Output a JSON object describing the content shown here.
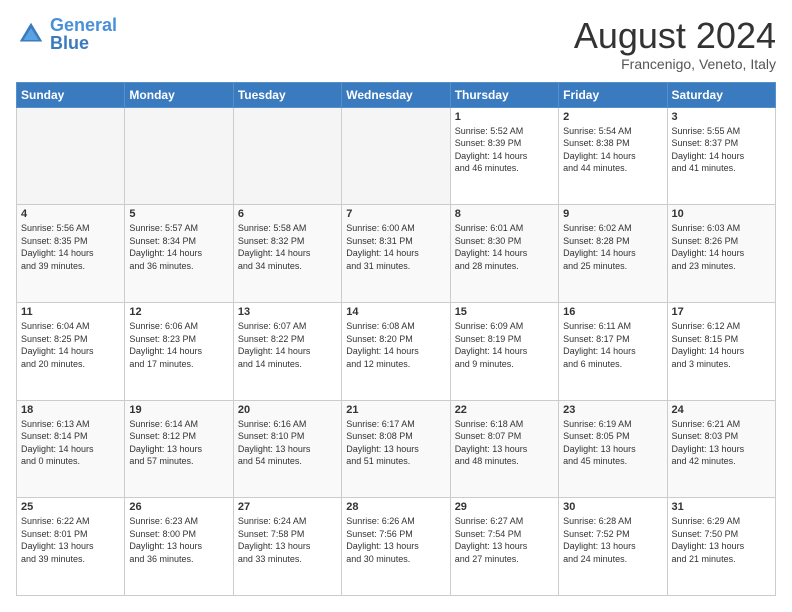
{
  "logo": {
    "line1": "General",
    "line2": "Blue"
  },
  "title": "August 2024",
  "subtitle": "Francenigo, Veneto, Italy",
  "days_of_week": [
    "Sunday",
    "Monday",
    "Tuesday",
    "Wednesday",
    "Thursday",
    "Friday",
    "Saturday"
  ],
  "weeks": [
    [
      {
        "day": "",
        "info": ""
      },
      {
        "day": "",
        "info": ""
      },
      {
        "day": "",
        "info": ""
      },
      {
        "day": "",
        "info": ""
      },
      {
        "day": "1",
        "info": "Sunrise: 5:52 AM\nSunset: 8:39 PM\nDaylight: 14 hours\nand 46 minutes."
      },
      {
        "day": "2",
        "info": "Sunrise: 5:54 AM\nSunset: 8:38 PM\nDaylight: 14 hours\nand 44 minutes."
      },
      {
        "day": "3",
        "info": "Sunrise: 5:55 AM\nSunset: 8:37 PM\nDaylight: 14 hours\nand 41 minutes."
      }
    ],
    [
      {
        "day": "4",
        "info": "Sunrise: 5:56 AM\nSunset: 8:35 PM\nDaylight: 14 hours\nand 39 minutes."
      },
      {
        "day": "5",
        "info": "Sunrise: 5:57 AM\nSunset: 8:34 PM\nDaylight: 14 hours\nand 36 minutes."
      },
      {
        "day": "6",
        "info": "Sunrise: 5:58 AM\nSunset: 8:32 PM\nDaylight: 14 hours\nand 34 minutes."
      },
      {
        "day": "7",
        "info": "Sunrise: 6:00 AM\nSunset: 8:31 PM\nDaylight: 14 hours\nand 31 minutes."
      },
      {
        "day": "8",
        "info": "Sunrise: 6:01 AM\nSunset: 8:30 PM\nDaylight: 14 hours\nand 28 minutes."
      },
      {
        "day": "9",
        "info": "Sunrise: 6:02 AM\nSunset: 8:28 PM\nDaylight: 14 hours\nand 25 minutes."
      },
      {
        "day": "10",
        "info": "Sunrise: 6:03 AM\nSunset: 8:26 PM\nDaylight: 14 hours\nand 23 minutes."
      }
    ],
    [
      {
        "day": "11",
        "info": "Sunrise: 6:04 AM\nSunset: 8:25 PM\nDaylight: 14 hours\nand 20 minutes."
      },
      {
        "day": "12",
        "info": "Sunrise: 6:06 AM\nSunset: 8:23 PM\nDaylight: 14 hours\nand 17 minutes."
      },
      {
        "day": "13",
        "info": "Sunrise: 6:07 AM\nSunset: 8:22 PM\nDaylight: 14 hours\nand 14 minutes."
      },
      {
        "day": "14",
        "info": "Sunrise: 6:08 AM\nSunset: 8:20 PM\nDaylight: 14 hours\nand 12 minutes."
      },
      {
        "day": "15",
        "info": "Sunrise: 6:09 AM\nSunset: 8:19 PM\nDaylight: 14 hours\nand 9 minutes."
      },
      {
        "day": "16",
        "info": "Sunrise: 6:11 AM\nSunset: 8:17 PM\nDaylight: 14 hours\nand 6 minutes."
      },
      {
        "day": "17",
        "info": "Sunrise: 6:12 AM\nSunset: 8:15 PM\nDaylight: 14 hours\nand 3 minutes."
      }
    ],
    [
      {
        "day": "18",
        "info": "Sunrise: 6:13 AM\nSunset: 8:14 PM\nDaylight: 14 hours\nand 0 minutes."
      },
      {
        "day": "19",
        "info": "Sunrise: 6:14 AM\nSunset: 8:12 PM\nDaylight: 13 hours\nand 57 minutes."
      },
      {
        "day": "20",
        "info": "Sunrise: 6:16 AM\nSunset: 8:10 PM\nDaylight: 13 hours\nand 54 minutes."
      },
      {
        "day": "21",
        "info": "Sunrise: 6:17 AM\nSunset: 8:08 PM\nDaylight: 13 hours\nand 51 minutes."
      },
      {
        "day": "22",
        "info": "Sunrise: 6:18 AM\nSunset: 8:07 PM\nDaylight: 13 hours\nand 48 minutes."
      },
      {
        "day": "23",
        "info": "Sunrise: 6:19 AM\nSunset: 8:05 PM\nDaylight: 13 hours\nand 45 minutes."
      },
      {
        "day": "24",
        "info": "Sunrise: 6:21 AM\nSunset: 8:03 PM\nDaylight: 13 hours\nand 42 minutes."
      }
    ],
    [
      {
        "day": "25",
        "info": "Sunrise: 6:22 AM\nSunset: 8:01 PM\nDaylight: 13 hours\nand 39 minutes."
      },
      {
        "day": "26",
        "info": "Sunrise: 6:23 AM\nSunset: 8:00 PM\nDaylight: 13 hours\nand 36 minutes."
      },
      {
        "day": "27",
        "info": "Sunrise: 6:24 AM\nSunset: 7:58 PM\nDaylight: 13 hours\nand 33 minutes."
      },
      {
        "day": "28",
        "info": "Sunrise: 6:26 AM\nSunset: 7:56 PM\nDaylight: 13 hours\nand 30 minutes."
      },
      {
        "day": "29",
        "info": "Sunrise: 6:27 AM\nSunset: 7:54 PM\nDaylight: 13 hours\nand 27 minutes."
      },
      {
        "day": "30",
        "info": "Sunrise: 6:28 AM\nSunset: 7:52 PM\nDaylight: 13 hours\nand 24 minutes."
      },
      {
        "day": "31",
        "info": "Sunrise: 6:29 AM\nSunset: 7:50 PM\nDaylight: 13 hours\nand 21 minutes."
      }
    ]
  ]
}
